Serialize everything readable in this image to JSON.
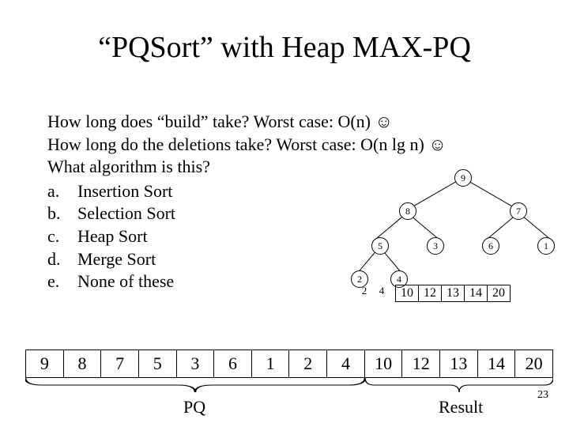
{
  "title": "“PQSort” with Heap MAX-PQ",
  "lines": {
    "l1a": "How long does “build” take?  Worst case: O(n) ",
    "l1smile": "☺",
    "l2a": "How long do the deletions take?  Worst case: O(n lg n) ",
    "l2smile": "☺",
    "l3": "What algorithm is this?"
  },
  "options": [
    {
      "label": "a.",
      "text": "Insertion Sort"
    },
    {
      "label": "b.",
      "text": "Selection Sort"
    },
    {
      "label": "c.",
      "text": "Heap Sort"
    },
    {
      "label": "d.",
      "text": "Merge Sort"
    },
    {
      "label": "e.",
      "text": "None of these"
    }
  ],
  "tree": {
    "n9": "9",
    "n8": "8",
    "n7": "7",
    "n5": "5",
    "n3": "3",
    "n6": "6",
    "n1": "1",
    "n2": "2",
    "n4": "4"
  },
  "mini_pre": [
    "2",
    "4"
  ],
  "mini_row": [
    "10",
    "12",
    "13",
    "14",
    "20"
  ],
  "bottom_row": [
    "9",
    "8",
    "7",
    "5",
    "3",
    "6",
    "1",
    "2",
    "4",
    "10",
    "12",
    "13",
    "14",
    "20"
  ],
  "pq_label": "PQ",
  "result_label": "Result",
  "slide_num": "23",
  "chart_data": {
    "type": "table",
    "title": "Heap tree and array state for PQSort with Heap MAX-PQ",
    "heap_levels": [
      [
        9
      ],
      [
        8,
        7
      ],
      [
        5,
        3,
        6,
        1
      ],
      [
        2,
        4
      ]
    ],
    "intermediate_result_row": [
      2,
      4,
      10,
      12,
      13,
      14,
      20
    ],
    "pq_array": [
      9,
      8,
      7,
      5,
      3,
      6,
      1,
      2,
      4
    ],
    "result_array": [
      10,
      12,
      13,
      14,
      20
    ]
  }
}
